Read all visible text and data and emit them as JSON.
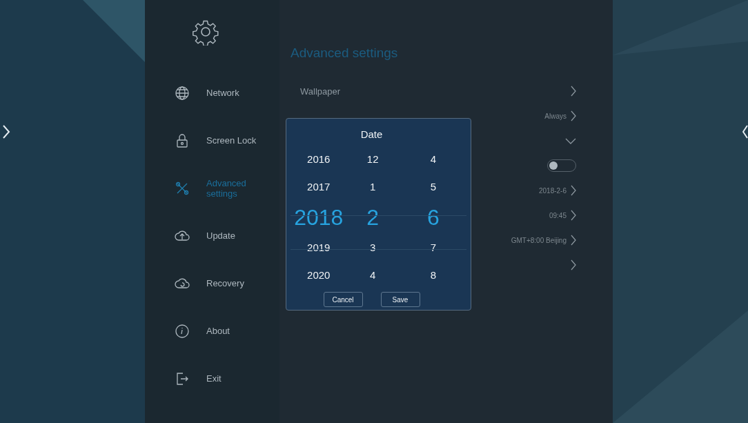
{
  "sidebar": {
    "items": [
      {
        "label": "Network",
        "selected": false
      },
      {
        "label": "Screen Lock",
        "selected": false
      },
      {
        "label": "Advanced settings",
        "selected": true
      },
      {
        "label": "Update",
        "selected": false
      },
      {
        "label": "Recovery",
        "selected": false
      },
      {
        "label": "About",
        "selected": false
      },
      {
        "label": "Exit",
        "selected": false
      }
    ]
  },
  "content": {
    "title": "Advanced settings",
    "rows": [
      {
        "kind": "link",
        "label": "Wallpaper"
      },
      {
        "kind": "link",
        "value": "Always"
      },
      {
        "kind": "expand"
      },
      {
        "kind": "toggle",
        "on": false
      },
      {
        "kind": "link",
        "value": "2018-2-6"
      },
      {
        "kind": "link",
        "value": "09:45"
      },
      {
        "kind": "link",
        "value": "GMT+8:00 Beijing"
      },
      {
        "kind": "link"
      }
    ]
  },
  "dialog": {
    "title": "Date",
    "columns": [
      [
        {
          "label": "2016",
          "selected": false
        },
        {
          "label": "2017",
          "selected": false
        },
        {
          "label": "2018",
          "selected": true
        },
        {
          "label": "2019",
          "selected": false
        },
        {
          "label": "2020",
          "selected": false
        }
      ],
      [
        {
          "label": "12",
          "selected": false
        },
        {
          "label": "1",
          "selected": false
        },
        {
          "label": "2",
          "selected": true
        },
        {
          "label": "3",
          "selected": false
        },
        {
          "label": "4",
          "selected": false
        }
      ],
      [
        {
          "label": "4",
          "selected": false
        },
        {
          "label": "5",
          "selected": false
        },
        {
          "label": "6",
          "selected": true
        },
        {
          "label": "7",
          "selected": false
        },
        {
          "label": "8",
          "selected": false
        }
      ]
    ],
    "buttons": [
      "Cancel",
      "Save"
    ]
  }
}
